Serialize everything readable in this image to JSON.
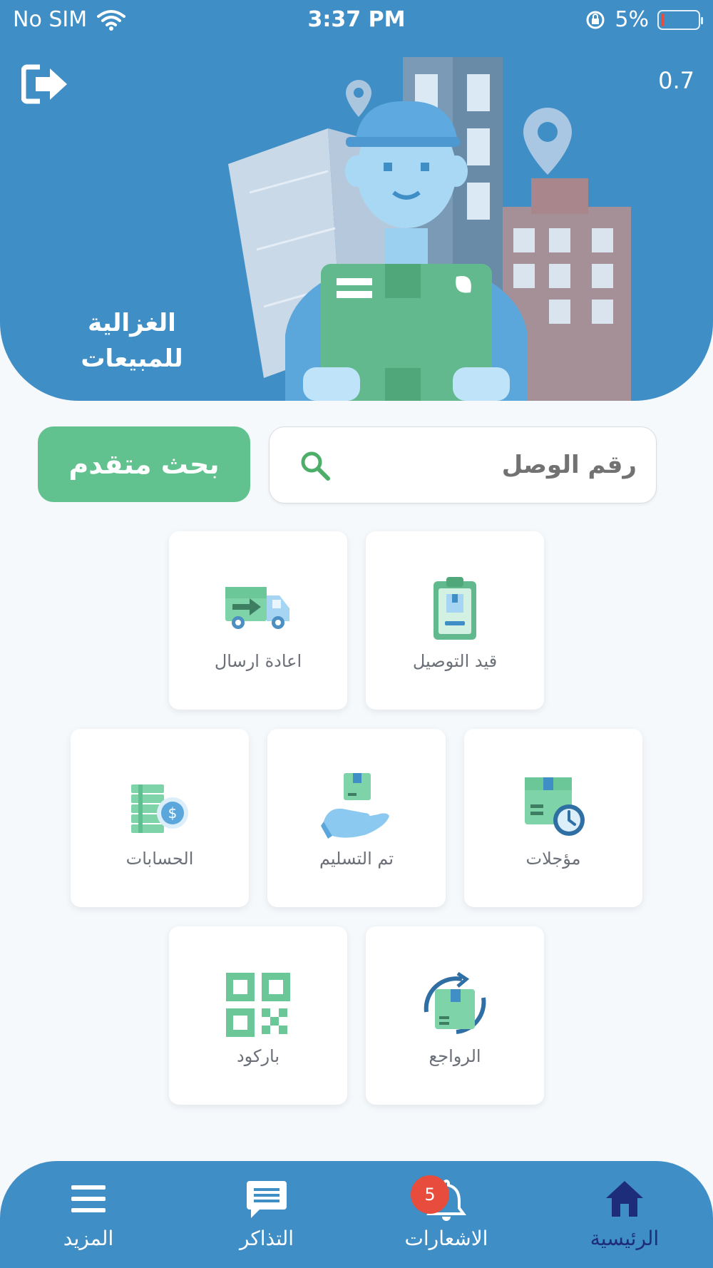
{
  "status_bar": {
    "carrier": "No SIM",
    "time": "3:37 PM",
    "battery": "5%"
  },
  "header": {
    "version": "0.7",
    "brand_line1": "الغزالية",
    "brand_line2": "للمبيعات"
  },
  "search": {
    "placeholder": "رقم الوصل",
    "advanced_label": "بحث متقدم"
  },
  "menu": {
    "pending_delivery": "قيد التوصيل",
    "resend": "اعادة ارسال",
    "postponed": "مؤجلات",
    "delivered": "تم التسليم",
    "accounts": "الحسابات",
    "returns": "الرواجع",
    "barcode": "باركود"
  },
  "nav": {
    "home": "الرئيسية",
    "notifications": "الاشعارات",
    "notifications_count": "5",
    "tickets": "التذاكر",
    "more": "المزيد"
  },
  "colors": {
    "primary": "#3f8ec6",
    "accent": "#62c28f",
    "active_nav": "#1e2d7a",
    "badge": "#e74c3c"
  },
  "icons": {
    "logout": "logout-arrow-icon",
    "search": "search-icon",
    "pending_delivery": "clipboard-icon",
    "resend": "truck-icon",
    "postponed": "box-clock-icon",
    "delivered": "hand-box-icon",
    "accounts": "money-stack-icon",
    "returns": "box-cycle-icon",
    "barcode": "qr-code-icon",
    "home": "home-icon",
    "notifications": "bell-icon",
    "tickets": "chat-icon",
    "more": "menu-icon"
  }
}
